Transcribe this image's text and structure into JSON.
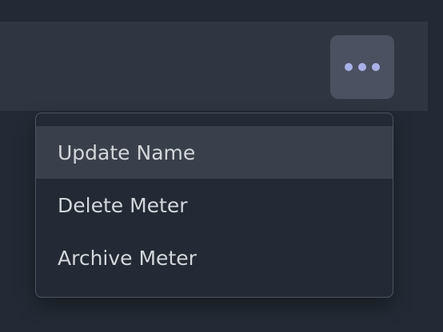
{
  "toolbar": {
    "more_button_icon": "ellipsis-horizontal-icon",
    "accent_color": "#a9b2e8"
  },
  "menu": {
    "items": [
      {
        "label": "Update Name",
        "highlighted": true
      },
      {
        "label": "Delete Meter",
        "highlighted": false
      },
      {
        "label": "Archive Meter",
        "highlighted": false
      }
    ]
  },
  "colors": {
    "background": "#232a35",
    "header_strip": "#2f3641",
    "button_bg": "#4a5160",
    "menu_highlight": "#3a404b",
    "menu_text": "#d3d6db",
    "menu_border": "#4c5360"
  }
}
